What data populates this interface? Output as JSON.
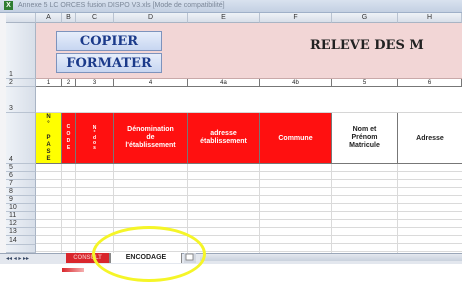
{
  "window": {
    "title": "Annexe 5 LC ORCES fusion DISPO V3.xls  [Mode de compatibilité]"
  },
  "columns": [
    "A",
    "B",
    "C",
    "D",
    "E",
    "F",
    "G",
    "H"
  ],
  "rows": [
    "1",
    "2",
    "3",
    "4",
    "5",
    "6",
    "7",
    "8",
    "9",
    "10",
    "11",
    "12",
    "13",
    "14"
  ],
  "buttons": {
    "copier": "COPIER",
    "formater": "FORMATER"
  },
  "sheet_title": "RELEVE DES M",
  "number_row": [
    "1",
    "2",
    "3",
    "4",
    "4a",
    "4b",
    "5",
    "6"
  ],
  "headers": {
    "col_a": "N\n°\n\nP\nA\nS\nE",
    "col_b": "C\nO\nD\nE",
    "col_c": "N\n°\nd\no\ns",
    "denomination": "Dénomination\nde\nl'établissement",
    "adresse_etab": "adresse\nétablissement",
    "commune": "Commune",
    "nom_prenom": "Nom et\nPrénom\nMatricule",
    "adresse": "Adresse"
  },
  "tabs": {
    "inactive_label": "CONSULT",
    "active_label": "ENCODAGE"
  },
  "nav_glyphs": "◂◂ ◂ ▸ ▸▸",
  "colors": {
    "red_header": "#ff1010",
    "yellow_header": "#ffff00",
    "title_band": "#f2d6d6",
    "annotation_circle": "#f5f528"
  }
}
